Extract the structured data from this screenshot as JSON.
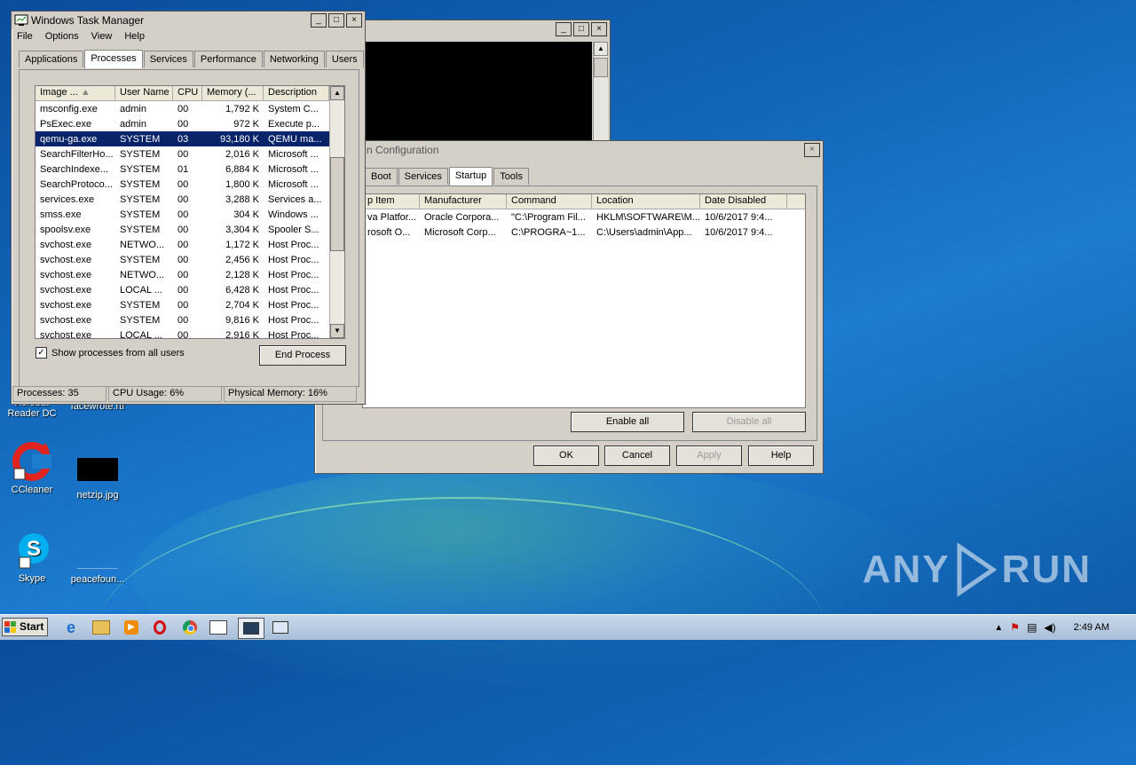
{
  "desktop": {
    "icons": [
      {
        "label": "CCleaner"
      },
      {
        "label": "netzip.jpg"
      },
      {
        "label": "Skype"
      },
      {
        "label": "peacefoun..."
      },
      {
        "label": "Acrobat\nReader DC"
      },
      {
        "label": "facewrote.rtf"
      }
    ],
    "watermark": "ANY RUN"
  },
  "msconfig": {
    "title": "n Configuration",
    "tabs": [
      "Boot",
      "Services",
      "Startup",
      "Tools"
    ],
    "active_tab": "Startup",
    "columns": [
      "p Item",
      "Manufacturer",
      "Command",
      "Location",
      "Date Disabled"
    ],
    "rows": [
      [
        "va Platfor...",
        "Oracle Corpora...",
        "\"C:\\Program Fil...",
        "HKLM\\SOFTWARE\\M...",
        "10/6/2017 9:4..."
      ],
      [
        "rosoft O...",
        "Microsoft Corp...",
        "C:\\PROGRA~1...",
        "C:\\Users\\admin\\App...",
        "10/6/2017 9:4..."
      ]
    ],
    "enable_all": "Enable all",
    "disable_all": "Disable all",
    "ok": "OK",
    "cancel": "Cancel",
    "apply": "Apply",
    "help": "Help"
  },
  "taskmgr": {
    "title": "Windows Task Manager",
    "menu": [
      "File",
      "Options",
      "View",
      "Help"
    ],
    "tabs": [
      "Applications",
      "Processes",
      "Services",
      "Performance",
      "Networking",
      "Users"
    ],
    "active_tab": "Processes",
    "columns": [
      "Image ...",
      "User Name",
      "CPU",
      "Memory (...",
      "Description"
    ],
    "rows": [
      [
        "msconfig.exe",
        "admin",
        "00",
        "1,792 K",
        "System C..."
      ],
      [
        "PsExec.exe",
        "admin",
        "00",
        "972 K",
        "Execute p..."
      ],
      [
        "qemu-ga.exe",
        "SYSTEM",
        "03",
        "93,180 K",
        "QEMU ma..."
      ],
      [
        "SearchFilterHo...",
        "SYSTEM",
        "00",
        "2,016 K",
        "Microsoft ..."
      ],
      [
        "SearchIndexe...",
        "SYSTEM",
        "01",
        "6,884 K",
        "Microsoft ..."
      ],
      [
        "SearchProtoco...",
        "SYSTEM",
        "00",
        "1,800 K",
        "Microsoft ..."
      ],
      [
        "services.exe",
        "SYSTEM",
        "00",
        "3,288 K",
        "Services a..."
      ],
      [
        "smss.exe",
        "SYSTEM",
        "00",
        "304 K",
        "Windows ..."
      ],
      [
        "spoolsv.exe",
        "SYSTEM",
        "00",
        "3,304 K",
        "Spooler S..."
      ],
      [
        "svchost.exe",
        "NETWO...",
        "00",
        "1,172 K",
        "Host Proc..."
      ],
      [
        "svchost.exe",
        "SYSTEM",
        "00",
        "2,456 K",
        "Host Proc..."
      ],
      [
        "svchost.exe",
        "NETWO...",
        "00",
        "2,128 K",
        "Host Proc..."
      ],
      [
        "svchost.exe",
        "LOCAL ...",
        "00",
        "6,428 K",
        "Host Proc..."
      ],
      [
        "svchost.exe",
        "SYSTEM",
        "00",
        "2,704 K",
        "Host Proc..."
      ],
      [
        "svchost.exe",
        "SYSTEM",
        "00",
        "9,816 K",
        "Host Proc..."
      ],
      [
        "svchost.exe",
        "LOCAL ...",
        "00",
        "2,916 K",
        "Host Proc..."
      ]
    ],
    "selected_row": "qemu-ga.exe",
    "show_all_label": "Show processes from all users",
    "show_all_checked": true,
    "end_process": "End Process",
    "status": {
      "processes": "Processes: 35",
      "cpu": "CPU Usage: 6%",
      "memory": "Physical Memory: 16%"
    }
  },
  "taskbar": {
    "start": "Start",
    "clock": "2:49 AM"
  }
}
